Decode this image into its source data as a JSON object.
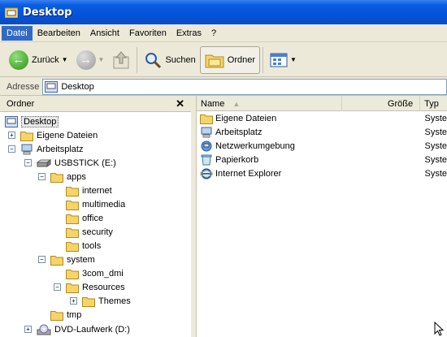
{
  "window": {
    "title": "Desktop"
  },
  "menu": [
    "Datei",
    "Bearbeiten",
    "Ansicht",
    "Favoriten",
    "Extras",
    "?"
  ],
  "toolbar": {
    "back_label": "Zurück",
    "search_label": "Suchen",
    "folders_label": "Ordner"
  },
  "address": {
    "label": "Adresse",
    "value": "Desktop"
  },
  "folder_pane": {
    "title": "Ordner",
    "tree": [
      {
        "label": "Desktop",
        "expander": "",
        "icon": "desktop-icon",
        "selected": true
      },
      {
        "label": "Eigene Dateien",
        "expander": "+",
        "icon": "folder-icon"
      },
      {
        "label": "Arbeitsplatz",
        "expander": "−",
        "icon": "computer-icon"
      },
      {
        "label": "USBSTICK (E:)",
        "expander": "−",
        "icon": "drive-icon"
      },
      {
        "label": "apps",
        "expander": "−",
        "icon": "folder-icon"
      },
      {
        "label": "internet",
        "expander": "",
        "icon": "folder-icon"
      },
      {
        "label": "multimedia",
        "expander": "",
        "icon": "folder-icon"
      },
      {
        "label": "office",
        "expander": "",
        "icon": "folder-icon"
      },
      {
        "label": "security",
        "expander": "",
        "icon": "folder-icon"
      },
      {
        "label": "tools",
        "expander": "",
        "icon": "folder-icon"
      },
      {
        "label": "system",
        "expander": "−",
        "icon": "folder-icon"
      },
      {
        "label": "3com_dmi",
        "expander": "",
        "icon": "folder-icon"
      },
      {
        "label": "Resources",
        "expander": "−",
        "icon": "folder-icon"
      },
      {
        "label": "Themes",
        "expander": "+",
        "icon": "folder-icon"
      },
      {
        "label": "tmp",
        "expander": "",
        "icon": "folder-icon"
      },
      {
        "label": "DVD-Laufwerk (D:)",
        "expander": "+",
        "icon": "dvd-icon"
      }
    ]
  },
  "list": {
    "columns": [
      "Name",
      "Größe",
      "Typ"
    ],
    "items": [
      {
        "name": "Eigene Dateien",
        "type": "Syste",
        "icon": "folder-icon"
      },
      {
        "name": "Arbeitsplatz",
        "type": "Syste",
        "icon": "computer-icon"
      },
      {
        "name": "Netzwerkumgebung",
        "type": "Syste",
        "icon": "network-icon"
      },
      {
        "name": "Papierkorb",
        "type": "Syste",
        "icon": "recycle-bin-icon"
      },
      {
        "name": "Internet Explorer",
        "type": "Syste",
        "icon": "ie-icon"
      }
    ]
  },
  "colors": {
    "titlebar": "#0453d8",
    "menu_active": "#316ac5",
    "folder": "#f5d46a"
  }
}
